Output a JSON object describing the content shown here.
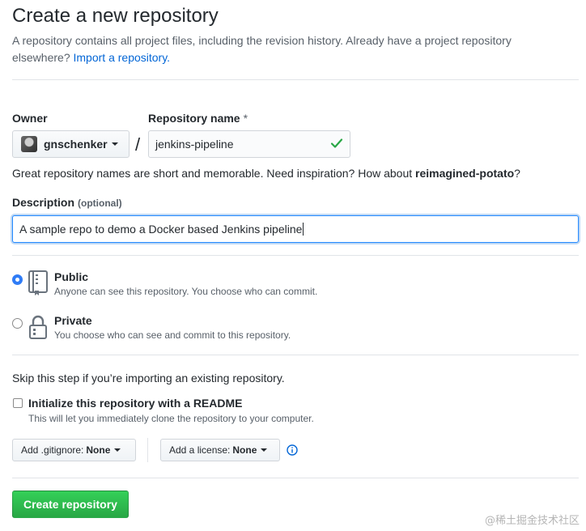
{
  "header": {
    "title": "Create a new repository",
    "subtitle_text": "A repository contains all project files, including the revision history. Already have a project repository elsewhere?",
    "import_link": "Import a repository."
  },
  "owner": {
    "label": "Owner",
    "value": "gnschenker"
  },
  "repo_name": {
    "label": "Repository name",
    "required_mark": "*",
    "value": "jenkins-pipeline",
    "valid": true
  },
  "name_hint": {
    "text": "Great repository names are short and memorable. Need inspiration? How about",
    "suggestion": "reimagined-potato",
    "end": "?"
  },
  "description": {
    "label": "Description",
    "optional": "(optional)",
    "value": "A sample repo to demo a Docker based Jenkins pipeline"
  },
  "visibility": {
    "selected": "public",
    "options": [
      {
        "title": "Public",
        "desc": "Anyone can see this repository. You choose who can commit."
      },
      {
        "title": "Private",
        "desc": "You choose who can see and commit to this repository."
      }
    ]
  },
  "import_note": "Skip this step if you’re importing an existing repository.",
  "readme": {
    "label": "Initialize this repository with a README",
    "desc": "This will let you immediately clone the repository to your computer.",
    "checked": false
  },
  "gitignore": {
    "label": "Add .gitignore:",
    "value": "None"
  },
  "license": {
    "label": "Add a license:",
    "value": "None"
  },
  "submit": {
    "label": "Create repository"
  },
  "watermark": "@稀土掘金技术社区",
  "colors": {
    "primary_button": "#28a745",
    "link": "#0366d6",
    "focus": "#2188ff",
    "valid_check": "#28a745"
  }
}
